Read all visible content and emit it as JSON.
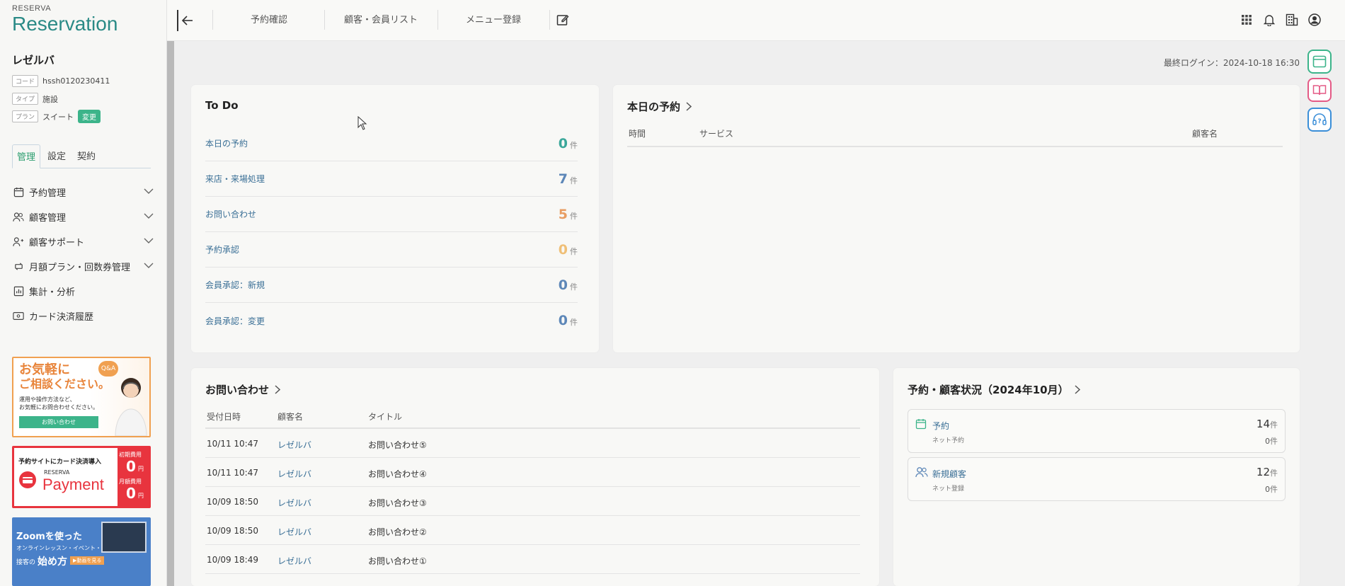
{
  "logo": {
    "small": "RESERVA",
    "big": "Reservation"
  },
  "facility": {
    "name": "レゼルバ",
    "code_tag": "コード",
    "code": "hssh0120230411",
    "type_tag": "タイプ",
    "type": "施設",
    "plan_tag": "プラン",
    "plan": "スイート",
    "plan_change": "変更"
  },
  "side_tabs": [
    "管理",
    "設定",
    "契約"
  ],
  "menu": [
    {
      "label": "予約管理",
      "icon": "calendar-icon",
      "chevron": true
    },
    {
      "label": "顧客管理",
      "icon": "users-icon",
      "chevron": true
    },
    {
      "label": "顧客サポート",
      "icon": "user-support-icon",
      "chevron": true
    },
    {
      "label": "月額プラン・回数券管理",
      "icon": "cycle-icon",
      "chevron": true
    },
    {
      "label": "集計・分析",
      "icon": "chart-icon",
      "chevron": false
    },
    {
      "label": "カード決済履歴",
      "icon": "card-icon",
      "chevron": false
    }
  ],
  "banners": {
    "b1": {
      "line1": "お気軽に",
      "line2": "ご相談ください。",
      "sub1": "運用や操作方法など、",
      "sub2": "お気軽にお問合わせください。",
      "button": "お問い合わせ",
      "qa": "Q&A"
    },
    "b2": {
      "top": "予約サイトにカード決済導入",
      "brand_small": "RESERVA",
      "brand": "Payment",
      "fee1_label": "初期費用",
      "fee1": "0",
      "fee2_label": "月額費用",
      "fee2": "0",
      "yen": "円"
    },
    "b3": {
      "line1": "Zoomを使った",
      "line2": "オンラインレッスン・イベント・",
      "line3_a": "接客の",
      "line3_b": "始め方",
      "button": "▶動画を見る"
    }
  },
  "header": {
    "links": [
      "予約確認",
      "顧客・会員リスト",
      "メニュー登録"
    ],
    "icons": [
      "grid-icon",
      "bell-icon",
      "building-icon",
      "account-icon"
    ]
  },
  "last_login": "最終ログイン：2024-10-18 16:30",
  "todo": {
    "title": "To Do",
    "unit": "件",
    "rows": [
      {
        "label": "本日の予約",
        "value": "0",
        "color": "#3aa79a"
      },
      {
        "label": "来店・来場処理",
        "value": "7",
        "color": "#5d87b8"
      },
      {
        "label": "お問い合わせ",
        "value": "5",
        "color": "#e89d63"
      },
      {
        "label": "予約承認",
        "value": "0",
        "color": "#efbf77"
      },
      {
        "label": "会員承認：新規",
        "value": "0",
        "color": "#5d87b8"
      },
      {
        "label": "会員承認：変更",
        "value": "0",
        "color": "#5d87b8"
      }
    ]
  },
  "today": {
    "title": "本日の予約",
    "cols": [
      "時間",
      "サービス",
      "顧客名"
    ]
  },
  "inquiry": {
    "title": "お問い合わせ",
    "cols": [
      "受付日時",
      "顧客名",
      "タイトル"
    ],
    "rows": [
      {
        "date": "10/11 10:47",
        "name": "レゼルバ",
        "title": "お問い合わせ⑤"
      },
      {
        "date": "10/11 10:47",
        "name": "レゼルバ",
        "title": "お問い合わせ④"
      },
      {
        "date": "10/09 18:50",
        "name": "レゼルバ",
        "title": "お問い合わせ③"
      },
      {
        "date": "10/09 18:50",
        "name": "レゼルバ",
        "title": "お問い合わせ②"
      },
      {
        "date": "10/09 18:49",
        "name": "レゼルバ",
        "title": "お問い合わせ①"
      }
    ]
  },
  "status": {
    "title": "予約・顧客状況（2024年10月）",
    "unit": "件",
    "items": [
      {
        "label": "予約",
        "sub": "ネット予約",
        "value": "14",
        "sub_value": "0",
        "icon": "calendar-icon"
      },
      {
        "label": "新規顧客",
        "sub": "ネット登録",
        "value": "12",
        "sub_value": "0",
        "icon": "users-icon"
      }
    ]
  },
  "colors": {
    "brand": "#2a8a86",
    "accent_green": "#3cb48a",
    "link_blue": "#3a6f96"
  }
}
